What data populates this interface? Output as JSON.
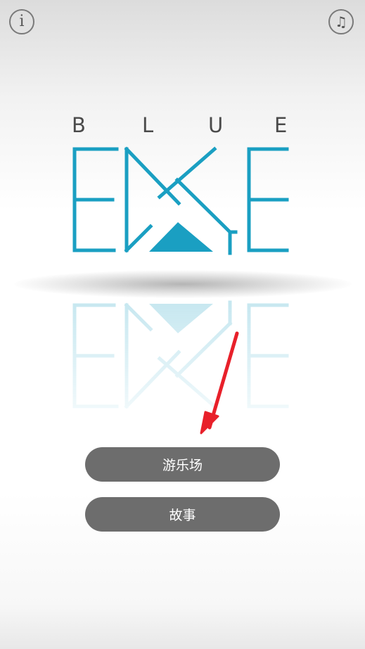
{
  "header": {
    "info_icon": "info-icon",
    "music_icon": "music-note-icon"
  },
  "logo": {
    "top_letters": [
      "B",
      "L",
      "U",
      "E"
    ],
    "wordmark": "EDGE",
    "color": "#1a9fc2"
  },
  "menu": {
    "playground_label": "游乐场",
    "story_label": "故事"
  },
  "annotation": {
    "arrow_color": "#e8202a"
  }
}
